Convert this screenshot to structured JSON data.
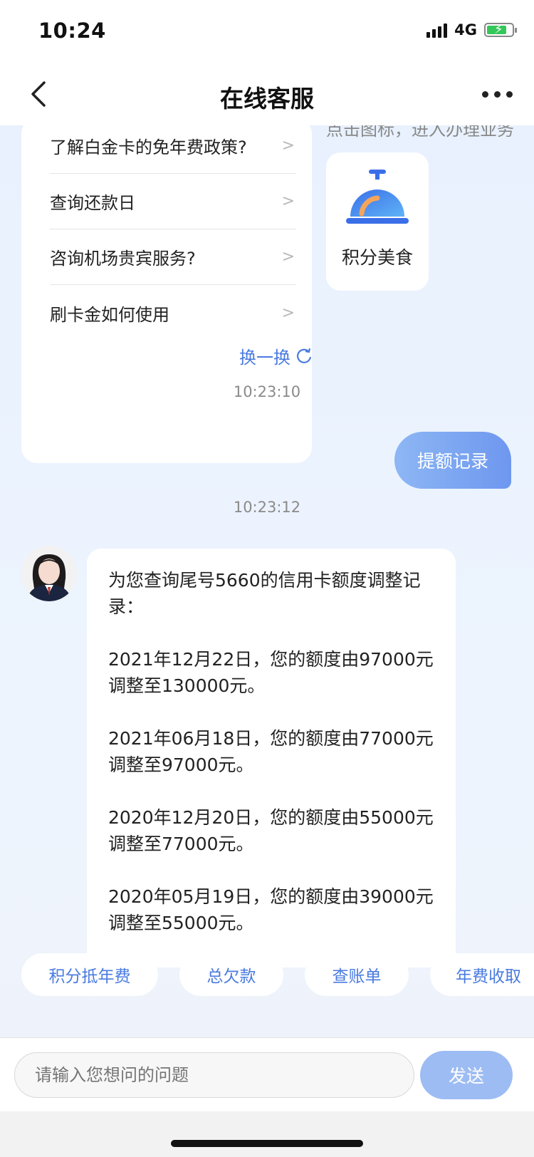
{
  "status_bar": {
    "time": "10:24",
    "network": "4G",
    "battery_percent": 80
  },
  "nav": {
    "title": "在线客服"
  },
  "faq": {
    "items": [
      {
        "label": "了解白金卡的免年费政策?"
      },
      {
        "label": "查询还款日"
      },
      {
        "label": "咨询机场贵宾服务?"
      },
      {
        "label": "刷卡金如何使用"
      }
    ],
    "arrow": ">",
    "refresh_label": "换一换"
  },
  "hint_text": "点击图标，进入办理业务",
  "food_card": {
    "label": "积分美食",
    "icon": "dining-bell-icon"
  },
  "messages": {
    "time_1": "10:23:10",
    "user_text": "提额记录",
    "time_2": "10:23:12",
    "bot_intro": "为您查询尾号5660的信用卡额度调整记录：",
    "records": [
      "2021年12月22日，您的额度由97000元调整至130000元。",
      "2021年06月18日，您的额度由77000元调整至97000元。",
      "2020年12月20日，您的额度由55000元调整至77000元。",
      "2020年05月19日，您的额度由39000元调整至55000元。"
    ]
  },
  "chips": [
    {
      "label": "积分抵年费"
    },
    {
      "label": "总欠款"
    },
    {
      "label": "查账单"
    },
    {
      "label": "年费收取"
    }
  ],
  "input": {
    "placeholder": "请输入您想问的问题",
    "send_label": "发送"
  },
  "colors": {
    "accent": "#4a7be0",
    "user_bubble": "#7aa3f1",
    "send_button": "#9dbcf3",
    "chat_bg": "#eaf2fd"
  }
}
